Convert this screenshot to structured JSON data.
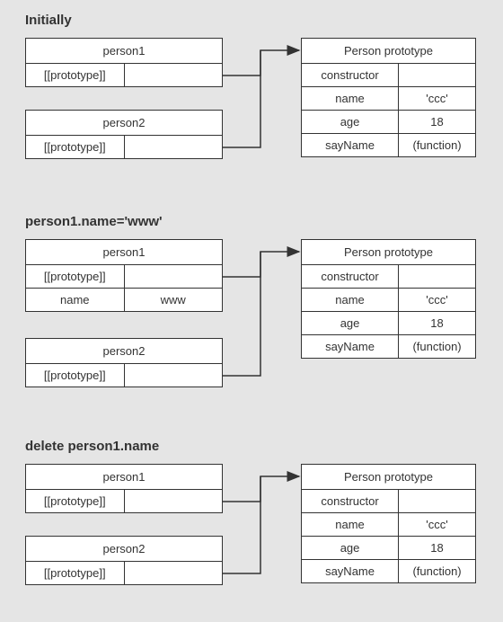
{
  "sections": [
    {
      "title": "Initially",
      "left": {
        "objects": [
          {
            "name": "person1",
            "rows": [
              {
                "key": "[[prototype]]",
                "val": ""
              }
            ]
          },
          {
            "name": "person2",
            "rows": [
              {
                "key": "[[prototype]]",
                "val": ""
              }
            ]
          }
        ]
      },
      "right": {
        "name": "Person prototype",
        "rows": [
          {
            "key": "constructor",
            "val": ""
          },
          {
            "key": "name",
            "val": "'ccc'"
          },
          {
            "key": "age",
            "val": "18"
          },
          {
            "key": "sayName",
            "val": "(function)"
          }
        ]
      }
    },
    {
      "title": "person1.name='www'",
      "left": {
        "objects": [
          {
            "name": "person1",
            "rows": [
              {
                "key": "[[prototype]]",
                "val": ""
              },
              {
                "key": "name",
                "val": "www"
              }
            ]
          },
          {
            "name": "person2",
            "rows": [
              {
                "key": "[[prototype]]",
                "val": ""
              }
            ]
          }
        ]
      },
      "right": {
        "name": "Person prototype",
        "rows": [
          {
            "key": "constructor",
            "val": ""
          },
          {
            "key": "name",
            "val": "'ccc'"
          },
          {
            "key": "age",
            "val": "18"
          },
          {
            "key": "sayName",
            "val": "(function)"
          }
        ]
      }
    },
    {
      "title": "delete person1.name",
      "left": {
        "objects": [
          {
            "name": "person1",
            "rows": [
              {
                "key": "[[prototype]]",
                "val": ""
              }
            ]
          },
          {
            "name": "person2",
            "rows": [
              {
                "key": "[[prototype]]",
                "val": ""
              }
            ]
          }
        ]
      },
      "right": {
        "name": "Person prototype",
        "rows": [
          {
            "key": "constructor",
            "val": ""
          },
          {
            "key": "name",
            "val": "'ccc'"
          },
          {
            "key": "age",
            "val": "18"
          },
          {
            "key": "sayName",
            "val": "(function)"
          }
        ]
      }
    }
  ]
}
